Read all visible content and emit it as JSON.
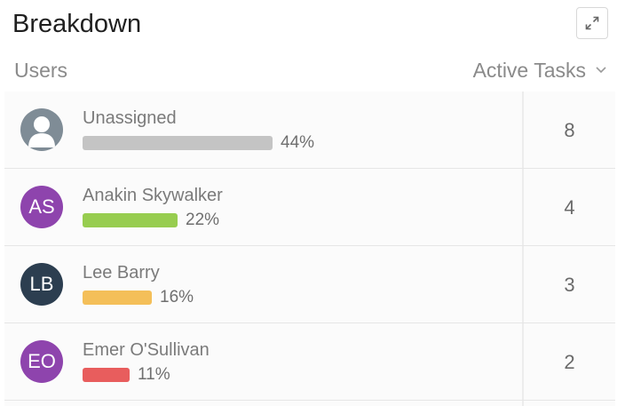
{
  "widget": {
    "title": "Breakdown",
    "expand_icon": "expand-arrows-icon"
  },
  "columns": {
    "users_label": "Users",
    "tasks_label": "Active Tasks",
    "tasks_dropdown_icon": "chevron-down-icon"
  },
  "rows": [
    {
      "name": "Unassigned",
      "avatar_type": "placeholder",
      "initials": "",
      "avatar_color": "#7f8c96",
      "percent": 44,
      "percent_label": "44%",
      "bar_color": "#c4c4c4",
      "count": "8"
    },
    {
      "name": "Anakin Skywalker",
      "avatar_type": "initials",
      "initials": "AS",
      "avatar_color": "#8e44ad",
      "percent": 22,
      "percent_label": "22%",
      "bar_color": "#97cd4f",
      "count": "4"
    },
    {
      "name": "Lee Barry",
      "avatar_type": "initials",
      "initials": "LB",
      "avatar_color": "#2c3e50",
      "percent": 16,
      "percent_label": "16%",
      "bar_color": "#f4bf59",
      "count": "3"
    },
    {
      "name": "Emer O'Sullivan",
      "avatar_type": "initials",
      "initials": "EO",
      "avatar_color": "#8e44ad",
      "percent": 11,
      "percent_label": "11%",
      "bar_color": "#e85d5d",
      "count": "2"
    }
  ]
}
